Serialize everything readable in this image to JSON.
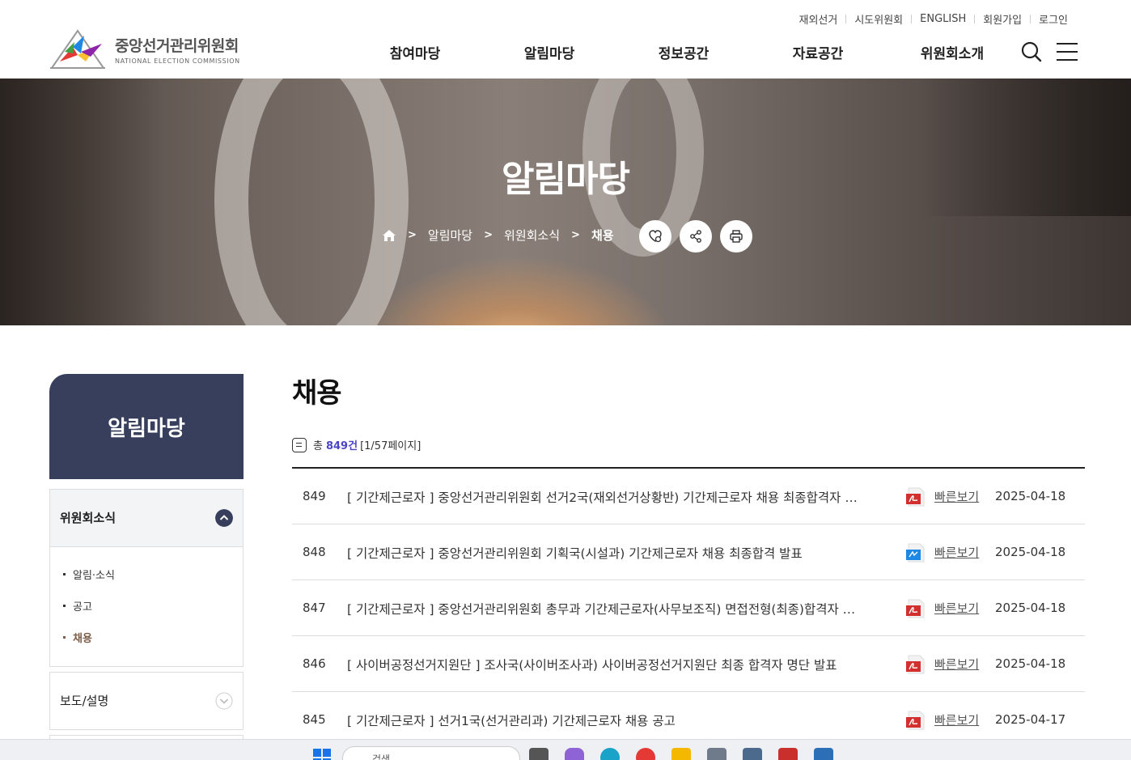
{
  "utility": [
    "재외선거",
    "시도위원회",
    "ENGLISH",
    "회원가입",
    "로그인"
  ],
  "logo": {
    "ko": "중앙선거관리위원회",
    "en": "NATIONAL ELECTION COMMISSION"
  },
  "gnb": [
    "참여마당",
    "알림마당",
    "정보공간",
    "자료공간",
    "위원회소개"
  ],
  "hero": {
    "title": "알림마당",
    "breadcrumb": [
      "알림마당",
      "위원회소식",
      "채용"
    ]
  },
  "lnb": {
    "title": "알림마당",
    "active_group": "위원회소식",
    "sub_items": [
      "알림·소식",
      "공고",
      "채용"
    ],
    "next_group": "보도/설명"
  },
  "content": {
    "title": "채용",
    "count_prefix": "총",
    "count": "849건",
    "page_info": "[1/57페이지]",
    "quick_view": "빠른보기",
    "rows": [
      {
        "no": "849",
        "title": "[ 기간제근로자 ] 중앙선거관리위원회 선거2국(재외선거상황반) 기간제근로자 채용 최종합격자 발표",
        "file": "pdf",
        "date": "2025-04-18"
      },
      {
        "no": "848",
        "title": "[ 기간제근로자 ] 중앙선거관리위원회 기획국(시설과) 기간제근로자 채용 최종합격 발표",
        "file": "hwp",
        "date": "2025-04-18"
      },
      {
        "no": "847",
        "title": "[ 기간제근로자 ] 중앙선거관리위원회 총무과 기간제근로자(사무보조직) 면접전형(최종)합격자 발표",
        "file": "pdf",
        "date": "2025-04-18"
      },
      {
        "no": "846",
        "title": "[ 사이버공정선거지원단 ] 조사국(사이버조사과) 사이버공정선거지원단 최종 합격자 명단 발표",
        "file": "pdf",
        "date": "2025-04-18"
      },
      {
        "no": "845",
        "title": "[ 기간제근로자 ] 선거1국(선거관리과) 기간제근로자 채용 공고",
        "file": "pdf",
        "date": "2025-04-17"
      }
    ]
  },
  "taskbar": {
    "search_placeholder": "검색"
  },
  "colors": {
    "lnb_head": "#373f5c",
    "accent_count": "#4b45c6",
    "active_sub": "#7b5f4a",
    "pdf": "#d32f2f",
    "hwp": "#1e88e5"
  },
  "icons": [
    "search-icon",
    "menu-icon",
    "home-icon",
    "favorite-icon",
    "share-icon",
    "print-icon",
    "chevron-up-icon",
    "chevron-down-icon",
    "list-icon",
    "pdf-icon",
    "hwp-icon"
  ]
}
